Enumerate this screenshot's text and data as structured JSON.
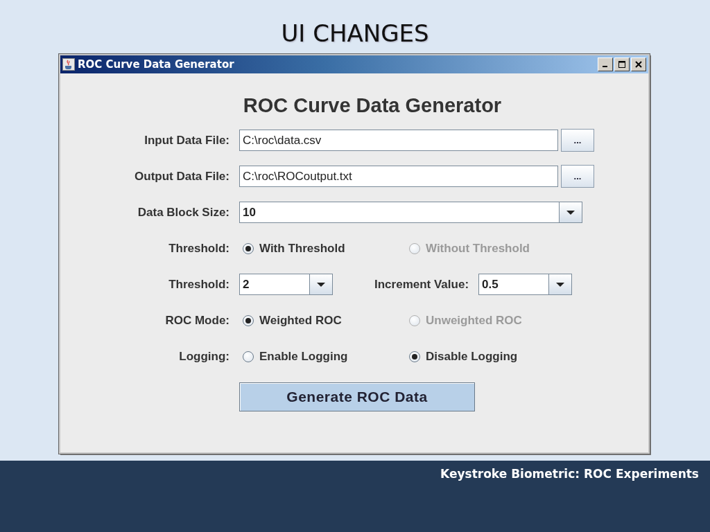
{
  "slide_title": "UI CHANGES",
  "window": {
    "title": "ROC Curve Data Generator",
    "heading": "ROC Curve Data Generator",
    "rows": [
      {
        "kind": "file",
        "label": "Input Data File:",
        "value": "C:\\roc\\data.csv",
        "button": "..."
      },
      {
        "kind": "file",
        "label": "Output Data File:",
        "value": "C:\\roc\\ROCoutput.txt",
        "button": "..."
      },
      {
        "kind": "combo",
        "label": "Data Block Size:",
        "value": "10"
      },
      {
        "kind": "radio",
        "label": "Threshold:",
        "options": [
          {
            "label": "With Threshold",
            "selected": true,
            "disabled": false
          },
          {
            "label": "Without Threshold",
            "selected": false,
            "disabled": true
          }
        ]
      },
      {
        "kind": "combo_pair",
        "label": "Threshold:",
        "value": "2",
        "label_2": "Increment Value:",
        "value_2": "0.5"
      },
      {
        "kind": "radio",
        "label": "ROC Mode:",
        "options": [
          {
            "label": "Weighted ROC",
            "selected": true,
            "disabled": false
          },
          {
            "label": "Unweighted ROC",
            "selected": false,
            "disabled": true
          }
        ]
      },
      {
        "kind": "radio",
        "label": "Logging:",
        "options": [
          {
            "label": "Enable Logging",
            "selected": false,
            "disabled": false
          },
          {
            "label": "Disable Logging",
            "selected": true,
            "disabled": false
          }
        ]
      }
    ],
    "action_button": "Generate ROC Data"
  },
  "footer": "Keystroke Biometric: ROC Experiments"
}
